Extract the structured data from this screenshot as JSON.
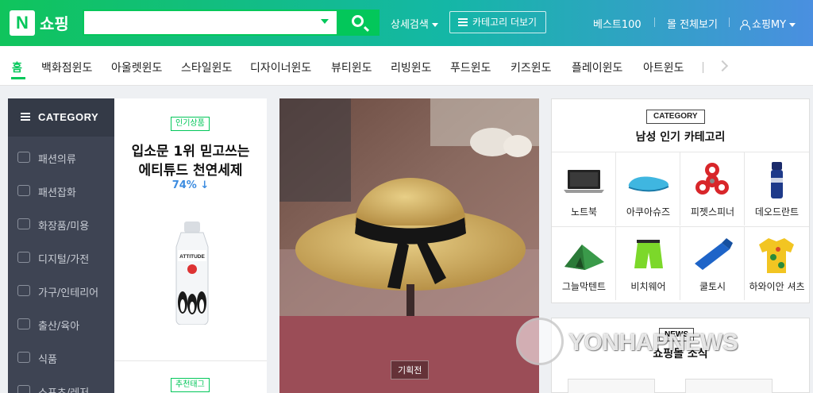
{
  "header": {
    "logo_badge": "N",
    "logo_text": "쇼핑",
    "search": {
      "value": "",
      "placeholder": ""
    },
    "detail_search": "상세검색",
    "category_more": "카테고리 더보기",
    "links": [
      "베스트100",
      "몰 전체보기",
      "쇼핑MY"
    ],
    "colors": {
      "green": "#03c75a",
      "gradient_end": "#4a8fe0"
    }
  },
  "nav": {
    "items": [
      "홈",
      "백화점윈도",
      "아울렛윈도",
      "스타일윈도",
      "디자이너윈도",
      "뷰티윈도",
      "리빙윈도",
      "푸드윈도",
      "키즈윈도",
      "플레이윈도",
      "아트윈도"
    ],
    "active_index": 0
  },
  "sidebar": {
    "title": "CATEGORY",
    "items": [
      {
        "label": "패션의류",
        "icon": "shirt-icon"
      },
      {
        "label": "패션잡화",
        "icon": "bag-icon"
      },
      {
        "label": "화장품/미용",
        "icon": "cosmetics-icon"
      },
      {
        "label": "디지털/가전",
        "icon": "camera-icon"
      },
      {
        "label": "가구/인테리어",
        "icon": "lamp-icon"
      },
      {
        "label": "출산/육아",
        "icon": "stroller-icon"
      },
      {
        "label": "식품",
        "icon": "apple-icon"
      },
      {
        "label": "스포츠/레저",
        "icon": "sports-icon"
      }
    ]
  },
  "promo": {
    "tag": "인기상품",
    "title_line1": "입소문 1위 믿고쓰는",
    "title_line2": "에티튜드 천연세제",
    "rate": "74% ↓",
    "bottle_brand": "ATTITUDE",
    "bottom_tag": "추천태그"
  },
  "hero": {
    "label": "기획전"
  },
  "category_grid": {
    "tag": "CATEGORY",
    "title": "남성 인기 카테고리",
    "items": [
      {
        "label": "노트북",
        "icon": "laptop-icon"
      },
      {
        "label": "아쿠아슈즈",
        "icon": "aqua-shoes-icon"
      },
      {
        "label": "피젯스피너",
        "icon": "fidget-spinner-icon"
      },
      {
        "label": "데오드란트",
        "icon": "deodorant-icon"
      },
      {
        "label": "그늘막텐트",
        "icon": "tent-icon"
      },
      {
        "label": "비치웨어",
        "icon": "swim-shorts-icon"
      },
      {
        "label": "쿨토시",
        "icon": "arm-sleeve-icon"
      },
      {
        "label": "하와이안 셔츠",
        "icon": "hawaiian-shirt-icon"
      }
    ]
  },
  "news": {
    "tag": "NEWS",
    "title": "쇼핑몰 소식"
  },
  "watermark": {
    "text": "YONHAPNEWS"
  }
}
